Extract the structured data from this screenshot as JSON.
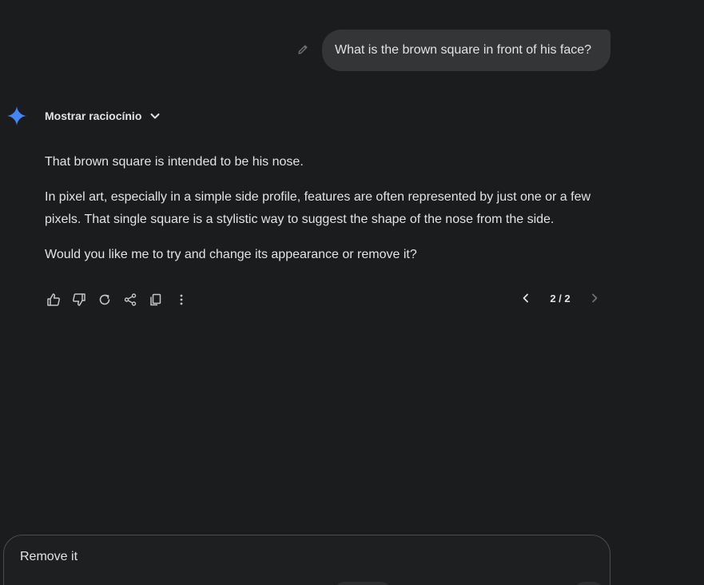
{
  "user_message": {
    "text": "What is the brown square in front of his face?"
  },
  "response": {
    "thinking_label": "Mostrar raciocínio",
    "paragraphs": [
      "That brown square is intended to be his nose.",
      "In pixel art, especially in a simple side profile, features are often represented by just one or a few pixels. That single square is a stylistic way to suggest the shape of the nose from the side.",
      "Would you like me to try and change its appearance or remove it?"
    ],
    "actions": [
      "thumbs-up-icon",
      "thumbs-down-icon",
      "regenerate-icon",
      "share-icon",
      "copy-icon",
      "more-vert-icon"
    ],
    "pager": "2 / 2"
  },
  "input": {
    "value": "Remove it"
  },
  "colors": {
    "background": "#1b1c1d",
    "bubble": "#333537",
    "text": "#e3e3e3",
    "gemini_blue": "#4285f4"
  }
}
